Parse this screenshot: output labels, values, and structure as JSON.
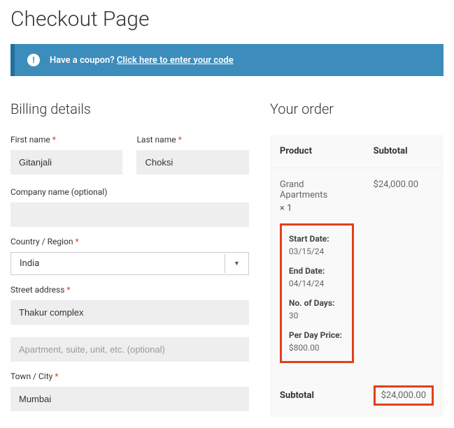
{
  "page": {
    "title": "Checkout Page"
  },
  "coupon": {
    "message": "Have a coupon?",
    "link": "Click here to enter your code"
  },
  "billing": {
    "heading": "Billing details",
    "first_name_label": "First name",
    "first_name_value": "Gitanjali",
    "last_name_label": "Last name",
    "last_name_value": "Choksi",
    "company_label": "Company name (optional)",
    "company_value": "",
    "country_label": "Country / Region",
    "country_value": "India",
    "street_label": "Street address",
    "street_value": "Thakur complex",
    "street2_placeholder": "Apartment, suite, unit, etc. (optional)",
    "town_label": "Town / City",
    "town_value": "Mumbai"
  },
  "order": {
    "heading": "Your order",
    "col_product": "Product",
    "col_subtotal": "Subtotal",
    "product_name": "Grand Apartments",
    "product_qty": "× 1",
    "product_subtotal": "$24,000.00",
    "meta": {
      "start_label": "Start Date:",
      "start_value": "03/15/24",
      "end_label": "End Date:",
      "end_value": "04/14/24",
      "days_label": "No. of Days:",
      "days_value": "30",
      "perday_label": "Per Day Price:",
      "perday_value": "$800.00"
    },
    "subtotal_label": "Subtotal",
    "subtotal_value": "$24,000.00"
  }
}
